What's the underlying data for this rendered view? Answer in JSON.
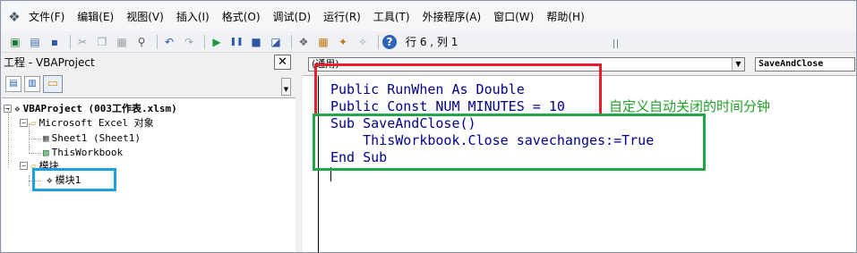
{
  "menubar": {
    "items": [
      "文件(F)",
      "编辑(E)",
      "视图(V)",
      "插入(I)",
      "格式(O)",
      "调试(D)",
      "运行(R)",
      "工具(T)",
      "外接程序(A)",
      "窗口(W)",
      "帮助(H)"
    ]
  },
  "toolbar": {
    "position_text": "行 6 , 列 1"
  },
  "project": {
    "title": "工程 - VBAProject",
    "close_glyph": "✕",
    "root": "VBAProject (003工作表.xlsm)",
    "folder_objects": "Microsoft Excel 对象",
    "sheet1": "Sheet1 (Sheet1)",
    "thisworkbook": "ThisWorkbook",
    "folder_modules": "模块",
    "module1": "模块1"
  },
  "code": {
    "object_box": "(通用)",
    "proc_box": "SaveAndClose",
    "lines": [
      "Public RunWhen As Double",
      "Public Const NUM_MINUTES = 10",
      "Sub SaveAndClose()",
      "    ThisWorkbook.Close savechanges:=True",
      "End Sub"
    ],
    "annotation": "自定义自动关闭的时间分钟"
  },
  "colors": {
    "code_text": "#00008b",
    "annotation": "#22a02a",
    "box_red": "#e5202a",
    "box_green": "#23a64a",
    "box_blue": "#1ba1e2"
  }
}
